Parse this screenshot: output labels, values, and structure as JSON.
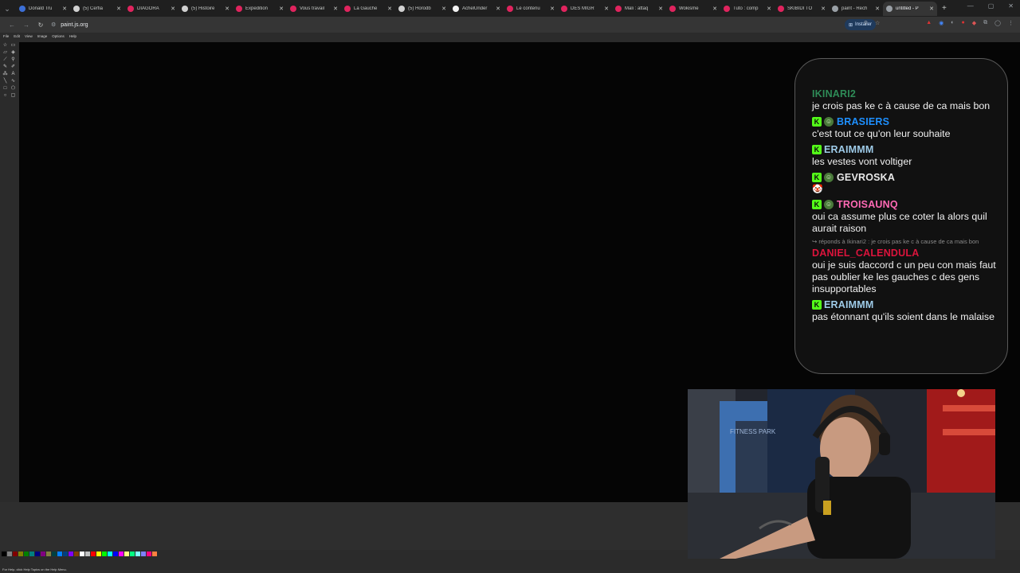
{
  "browser": {
    "tabs": [
      {
        "title": "Donald Tru",
        "color": "#3c6fd6"
      },
      {
        "title": "(5) Cerfia",
        "color": "#d0d0d0"
      },
      {
        "title": "DIAGORA",
        "color": "#e0245e"
      },
      {
        "title": "(5) Histoire",
        "color": "#d0d0d0"
      },
      {
        "title": "Expedition",
        "color": "#e0245e"
      },
      {
        "title": "Vous travail",
        "color": "#e0245e"
      },
      {
        "title": "La Gauche",
        "color": "#e0245e"
      },
      {
        "title": "(5) Horodb",
        "color": "#d0d0d0"
      },
      {
        "title": "AchelUnder",
        "color": "#f2f2f2"
      },
      {
        "title": "Le contenu",
        "color": "#e0245e"
      },
      {
        "title": "DES MIGR",
        "color": "#e0245e"
      },
      {
        "title": "Mali : attaq",
        "color": "#e0245e"
      },
      {
        "title": "Wokisme",
        "color": "#e0245e"
      },
      {
        "title": "Tuto : comp",
        "color": "#e0245e"
      },
      {
        "title": "SKIBIDI TO",
        "color": "#e0245e"
      },
      {
        "title": "paint - Rech",
        "color": "#9aa0a6"
      },
      {
        "title": "untitled - P",
        "color": "#9aa0a6",
        "active": true
      }
    ],
    "url": "paint.js.org",
    "install_label": "Installer"
  },
  "paint": {
    "menu": [
      "File",
      "Edit",
      "View",
      "Image",
      "Options",
      "Help"
    ],
    "status": "For Help, click Help Topics on the Help Menu.",
    "palette": [
      "#000000",
      "#808080",
      "#800000",
      "#808000",
      "#008000",
      "#008080",
      "#000080",
      "#800080",
      "#808040",
      "#004040",
      "#0080ff",
      "#004080",
      "#8000ff",
      "#804000",
      "#ffffff",
      "#c0c0c0",
      "#ff0000",
      "#ffff00",
      "#00ff00",
      "#00ffff",
      "#0000ff",
      "#ff00ff",
      "#ffff80",
      "#00ff80",
      "#80ffff",
      "#8080ff",
      "#ff0080",
      "#ff8040"
    ]
  },
  "chat": {
    "messages": [
      {
        "user": "IKINARI2",
        "color": "#2e8b57",
        "badges": [],
        "text": "je crois pas ke c à cause de ca mais bon"
      },
      {
        "user": "BRASIERS",
        "color": "#1e90ff",
        "badges": [
          "k",
          "g"
        ],
        "text": "c'est tout ce qu'on leur souhaite"
      },
      {
        "user": "ERAIMMM",
        "color": "#9ecbe8",
        "badges": [
          "k"
        ],
        "text": "les vestes vont voltiger"
      },
      {
        "user": "GEVROSKA",
        "color": "#e8e8e8",
        "badges": [
          "k",
          "g"
        ],
        "text": "",
        "emote": "🤡"
      },
      {
        "user": "TROISAUNQ",
        "color": "#ff69b4",
        "badges": [
          "k",
          "g"
        ],
        "text": "oui ca assume plus ce coter la alors quil aurait raison"
      },
      {
        "user": "DANIEL_CALENDULA",
        "color": "#dc143c",
        "badges": [],
        "reply": "↪ réponds à Ikinari2 : je crois pas ke c à cause de ca mais bon",
        "text": "oui je suis daccord c un peu con mais faut pas oublier ke les gauches c des gens insupportables"
      },
      {
        "user": "ERAIMMM",
        "color": "#9ecbe8",
        "badges": [
          "k"
        ],
        "text": "pas étonnant qu'ils soient dans le malaise"
      }
    ]
  },
  "webcam": {
    "wall_text": "FITNESS PARK"
  }
}
